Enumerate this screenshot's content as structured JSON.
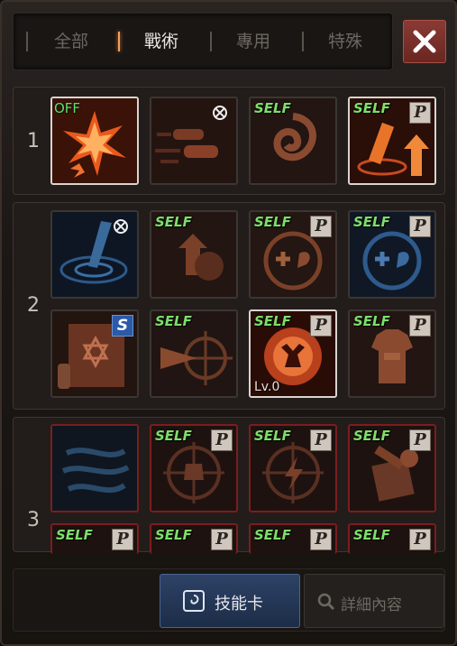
{
  "tabs": [
    "全部",
    "戰術",
    "專用",
    "特殊"
  ],
  "active_tab": "戰術",
  "rows": [
    {
      "number": "1"
    },
    {
      "number": "2"
    },
    {
      "number": "3"
    }
  ],
  "tags": {
    "self": "SELF",
    "off": "OFF",
    "passive": "P",
    "special": "S",
    "level": "Lv.0"
  },
  "bottom": {
    "skill_card": "技能卡",
    "details": "詳細內容"
  },
  "colors": {
    "accent_orange": "#f08040",
    "self_green": "#7dde6a",
    "close_red": "#8a3a34",
    "card_blue": "#2d4266"
  },
  "icons": [
    "close-icon",
    "lock-icon",
    "skill-card-icon",
    "search-icon"
  ]
}
